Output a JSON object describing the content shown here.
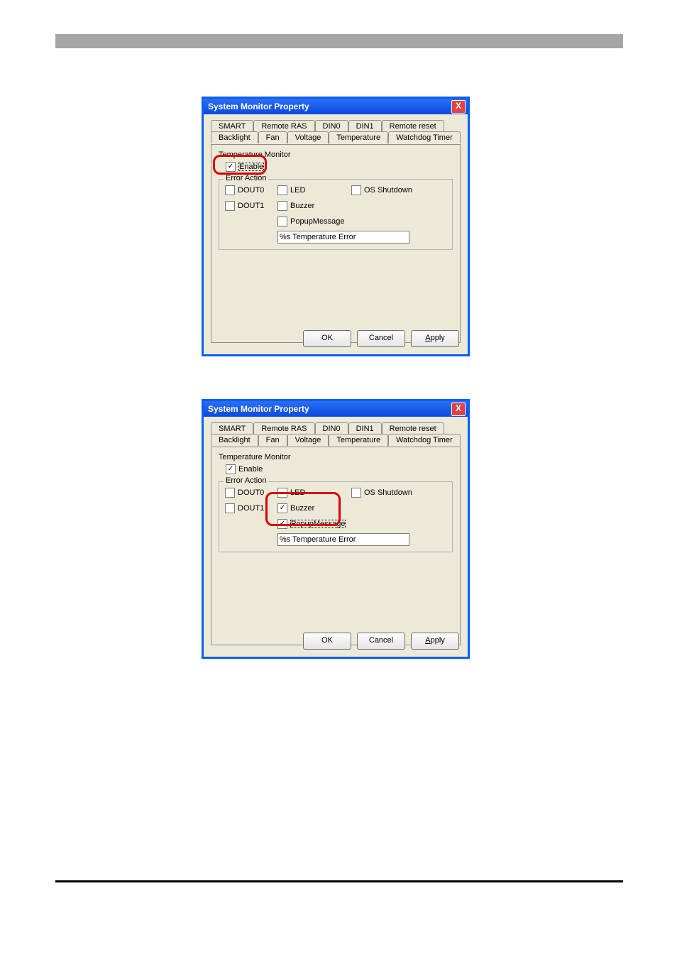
{
  "window_title": "System Monitor Property",
  "close_label": "X",
  "tabs_row1": [
    "SMART",
    "Remote RAS",
    "DIN0",
    "DIN1",
    "Remote reset"
  ],
  "tabs_row2": [
    "Backlight",
    "Fan",
    "Voltage",
    "Temperature",
    "Watchdog Timer"
  ],
  "selected_tab": "Temperature",
  "group_title": "Temperature Monitor",
  "enable_label": "Enable",
  "error_action_label": "Error Action",
  "checkboxes": {
    "dout0": "DOUT0",
    "dout1": "DOUT1",
    "led": "LED",
    "buzzer": "Buzzer",
    "os_shutdown": "OS Shutdown",
    "popup": "PopupMessage"
  },
  "popup_text_value": "%s Temperature Error",
  "buttons": {
    "ok": "OK",
    "cancel": "Cancel",
    "apply": "Apply"
  },
  "dialog1_state": {
    "enable": true,
    "dout0": false,
    "dout1": false,
    "led": false,
    "buzzer": false,
    "os_shutdown": false,
    "popup": false
  },
  "dialog2_state": {
    "enable": true,
    "dout0": false,
    "dout1": false,
    "led": false,
    "buzzer": true,
    "os_shutdown": false,
    "popup": true
  }
}
